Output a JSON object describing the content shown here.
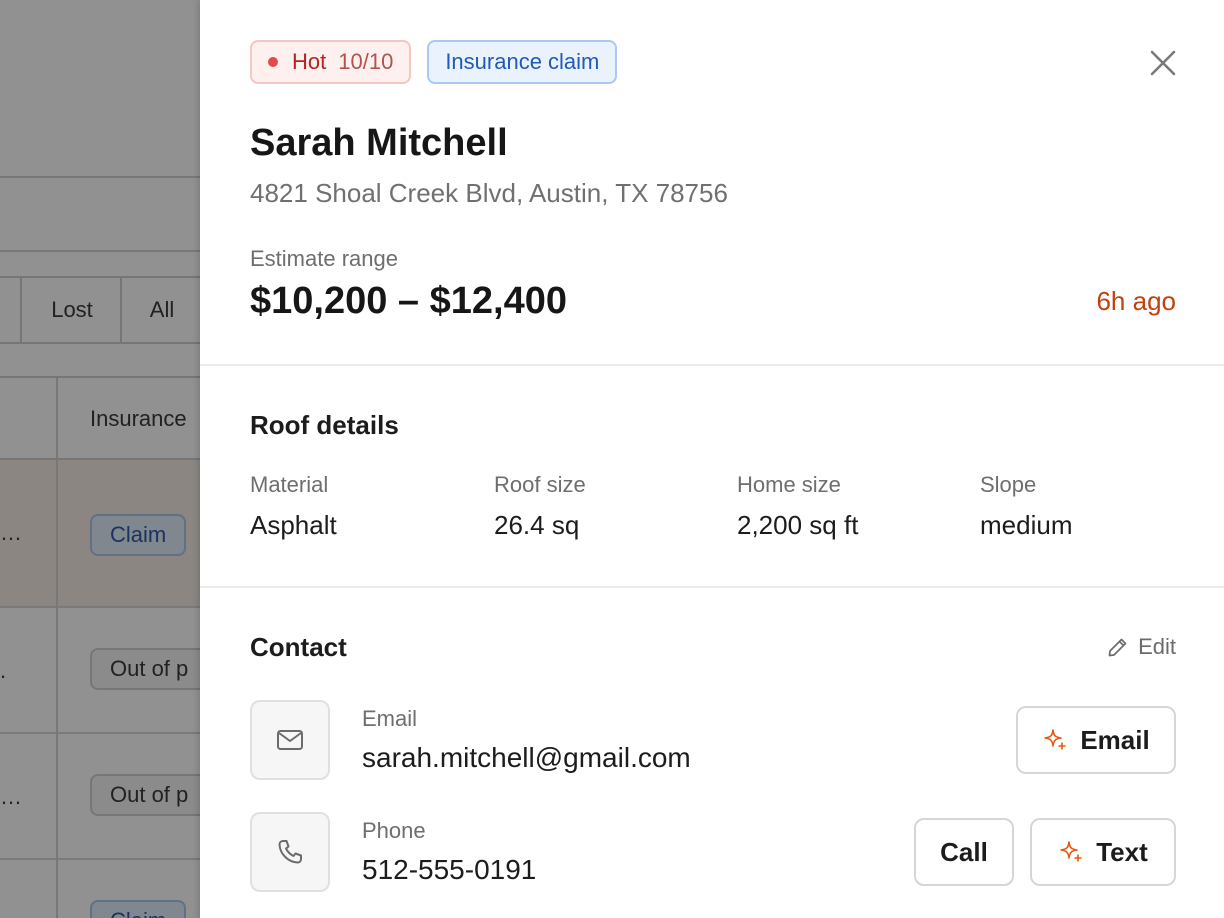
{
  "background": {
    "filters": [
      "Lost",
      "All"
    ],
    "column_header": "Insurance",
    "rows": [
      {
        "prefix": "…",
        "type": "Claim"
      },
      {
        "prefix": ".",
        "type": "Out of p"
      },
      {
        "prefix": "…",
        "type": "Out of p"
      },
      {
        "prefix": "",
        "type": "Claim"
      }
    ]
  },
  "lead": {
    "badges": {
      "hot_label": "Hot",
      "hot_score": "10/10",
      "type": "Insurance claim"
    },
    "name": "Sarah Mitchell",
    "address": "4821 Shoal Creek Blvd, Austin, TX 78756",
    "estimate_label": "Estimate range",
    "estimate_value": "$10,200 – $12,400",
    "time_ago": "6h ago"
  },
  "roof": {
    "title": "Roof details",
    "details": [
      {
        "label": "Material",
        "value": "Asphalt"
      },
      {
        "label": "Roof size",
        "value": "26.4 sq"
      },
      {
        "label": "Home size",
        "value": "2,200 sq ft"
      },
      {
        "label": "Slope",
        "value": "medium"
      }
    ]
  },
  "contact": {
    "title": "Contact",
    "edit_label": "Edit",
    "email_label": "Email",
    "email_value": "sarah.mitchell@gmail.com",
    "email_button": "Email",
    "phone_label": "Phone",
    "phone_value": "512-555-0191",
    "call_button": "Call",
    "text_button": "Text"
  },
  "colors": {
    "hot_accent": "#e5484d",
    "time_ago": "#c2410c",
    "ai_sparkle": "#ea580c",
    "insurance_badge": "#2259b6"
  }
}
